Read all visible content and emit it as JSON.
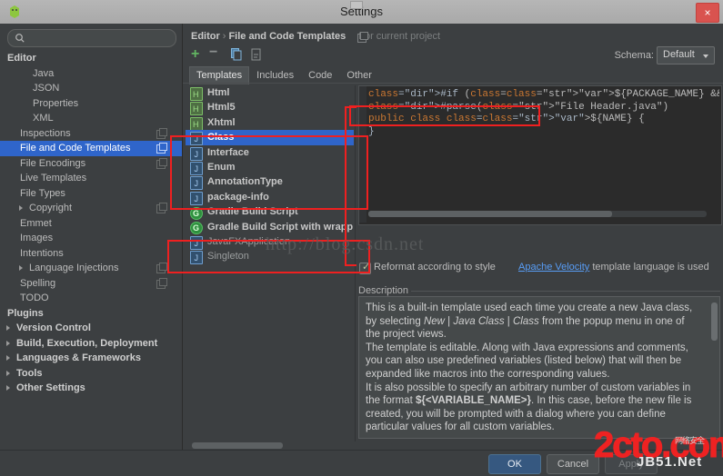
{
  "window": {
    "title": "Settings",
    "close_label": "×",
    "app_icon": "android-studio-icon"
  },
  "sidebar": {
    "search_placeholder": "",
    "items": [
      {
        "label": "Editor",
        "depth": 0,
        "bold": true,
        "arrow": false,
        "scope": false,
        "selected": false
      },
      {
        "label": "Java",
        "depth": 2,
        "bold": false,
        "arrow": false,
        "scope": false,
        "selected": false
      },
      {
        "label": "JSON",
        "depth": 2,
        "bold": false,
        "arrow": false,
        "scope": false,
        "selected": false
      },
      {
        "label": "Properties",
        "depth": 2,
        "bold": false,
        "arrow": false,
        "scope": false,
        "selected": false
      },
      {
        "label": "XML",
        "depth": 2,
        "bold": false,
        "arrow": false,
        "scope": false,
        "selected": false
      },
      {
        "label": "Inspections",
        "depth": 1,
        "bold": false,
        "arrow": false,
        "scope": true,
        "selected": false
      },
      {
        "label": "File and Code Templates",
        "depth": 1,
        "bold": false,
        "arrow": false,
        "scope": true,
        "selected": true
      },
      {
        "label": "File Encodings",
        "depth": 1,
        "bold": false,
        "arrow": false,
        "scope": true,
        "selected": false
      },
      {
        "label": "Live Templates",
        "depth": 1,
        "bold": false,
        "arrow": false,
        "scope": false,
        "selected": false
      },
      {
        "label": "File Types",
        "depth": 1,
        "bold": false,
        "arrow": false,
        "scope": false,
        "selected": false
      },
      {
        "label": "Copyright",
        "depth": 1,
        "bold": false,
        "arrow": true,
        "scope": true,
        "selected": false
      },
      {
        "label": "Emmet",
        "depth": 1,
        "bold": false,
        "arrow": false,
        "scope": false,
        "selected": false
      },
      {
        "label": "Images",
        "depth": 1,
        "bold": false,
        "arrow": false,
        "scope": false,
        "selected": false
      },
      {
        "label": "Intentions",
        "depth": 1,
        "bold": false,
        "arrow": false,
        "scope": false,
        "selected": false
      },
      {
        "label": "Language Injections",
        "depth": 1,
        "bold": false,
        "arrow": true,
        "scope": true,
        "selected": false
      },
      {
        "label": "Spelling",
        "depth": 1,
        "bold": false,
        "arrow": false,
        "scope": true,
        "selected": false
      },
      {
        "label": "TODO",
        "depth": 1,
        "bold": false,
        "arrow": false,
        "scope": false,
        "selected": false
      },
      {
        "label": "Plugins",
        "depth": 0,
        "bold": true,
        "arrow": false,
        "scope": false,
        "selected": false
      },
      {
        "label": "Version Control",
        "depth": 0,
        "bold": true,
        "arrow": true,
        "scope": false,
        "selected": false
      },
      {
        "label": "Build, Execution, Deployment",
        "depth": 0,
        "bold": true,
        "arrow": true,
        "scope": false,
        "selected": false
      },
      {
        "label": "Languages & Frameworks",
        "depth": 0,
        "bold": true,
        "arrow": true,
        "scope": false,
        "selected": false
      },
      {
        "label": "Tools",
        "depth": 0,
        "bold": true,
        "arrow": true,
        "scope": false,
        "selected": false
      },
      {
        "label": "Other Settings",
        "depth": 0,
        "bold": true,
        "arrow": true,
        "scope": false,
        "selected": false
      }
    ]
  },
  "breadcrumb": {
    "root": "Editor",
    "separator": "›",
    "current": "File and Code Templates",
    "scope_note": "For current project"
  },
  "schema": {
    "label": "Schema:",
    "value": "Default"
  },
  "toolbar": {
    "add": "+",
    "remove": "−",
    "copy_icon": "copy-template-icon",
    "reset_icon": "reset-template-icon"
  },
  "tabs": [
    {
      "label": "Templates",
      "active": true
    },
    {
      "label": "Includes",
      "active": false
    },
    {
      "label": "Code",
      "active": false
    },
    {
      "label": "Other",
      "active": false
    }
  ],
  "templates": [
    {
      "label": "Html",
      "icon": "html",
      "bold": true,
      "selected": false,
      "dim": false
    },
    {
      "label": "Html5",
      "icon": "html",
      "bold": true,
      "selected": false,
      "dim": false
    },
    {
      "label": "Xhtml",
      "icon": "html",
      "bold": true,
      "selected": false,
      "dim": false
    },
    {
      "label": "Class",
      "icon": "java",
      "bold": true,
      "selected": true,
      "dim": false
    },
    {
      "label": "Interface",
      "icon": "java",
      "bold": true,
      "selected": false,
      "dim": false
    },
    {
      "label": "Enum",
      "icon": "java",
      "bold": true,
      "selected": false,
      "dim": false
    },
    {
      "label": "AnnotationType",
      "icon": "java",
      "bold": true,
      "selected": false,
      "dim": false
    },
    {
      "label": "package-info",
      "icon": "java",
      "bold": true,
      "selected": false,
      "dim": false
    },
    {
      "label": "Gradle Build Script",
      "icon": "gradle",
      "bold": true,
      "selected": false,
      "dim": false
    },
    {
      "label": "Gradle Build Script with wrapp",
      "icon": "gradle",
      "bold": true,
      "selected": false,
      "dim": false
    },
    {
      "label": "JavaFXApplication",
      "icon": "java",
      "bold": false,
      "selected": false,
      "dim": true
    },
    {
      "label": "Singleton",
      "icon": "java",
      "bold": false,
      "selected": false,
      "dim": true
    }
  ],
  "editor": {
    "lines": [
      "#if (${PACKAGE_NAME} && ${PACKAGE_NAME} != \"\")package ${",
      "#parse(\"File Header.java\")",
      "public class ${NAME} {",
      "}"
    ]
  },
  "reformat": {
    "label": "Reformat according to style",
    "checked": true,
    "velocity_link": "Apache Velocity",
    "velocity_rest": " template language is used"
  },
  "description": {
    "legend": "Description",
    "paragraphs": [
      "This is a built-in template used each time you create a new Java class, by selecting <i>New</i> | <i>Java Class</i> | <i>Class</i> from the popup menu in one of the project views.",
      "The template is editable. Along with Java expressions and comments, you can also use predefined variables (listed below) that will then be expanded like macros into the corresponding values.",
      "It is also possible to specify an arbitrary number of custom variables in the format <b>${&lt;VARIABLE_NAME&gt;}</b>. In this case, before the new file is created, you will be prompted with a dialog where you can define particular values for all custom variables."
    ]
  },
  "buttons": {
    "ok": "OK",
    "cancel": "Cancel",
    "apply": "Apply"
  },
  "watermarks": {
    "blog": "http://blog.csdn.net",
    "brand": "2cto.com",
    "sub": "JB51.Net",
    "cn": "网络安全"
  }
}
